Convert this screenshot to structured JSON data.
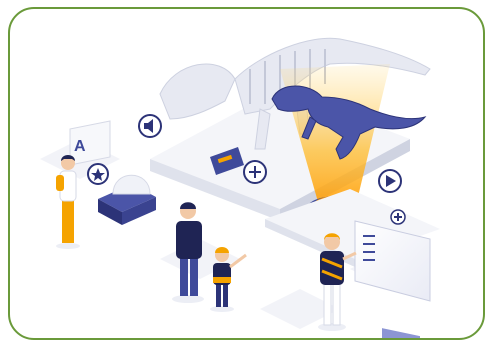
{
  "colors": {
    "frame_border": "#6a9a3a",
    "platform_top": "#f4f5f9",
    "platform_side": "#dfe2ec",
    "hologram_glow": "#ffb000",
    "dino_hologram": "#4b55a8",
    "skeleton": "#e7e9f2",
    "accent_blue": "#3f4a9a",
    "accent_orange": "#f5a300"
  },
  "icons": {
    "sound": "speaker-icon",
    "play": "play-icon",
    "add": "plus-icon",
    "star": "star-icon"
  },
  "sign": {
    "letter": "A"
  }
}
